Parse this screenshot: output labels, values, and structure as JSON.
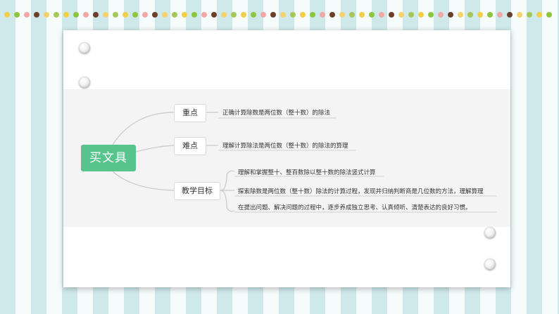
{
  "mindmap": {
    "root": "买文具",
    "topics": [
      {
        "label": "重点",
        "items": [
          "正确计算除数是两位数（整十数）的除法"
        ]
      },
      {
        "label": "难点",
        "items": [
          "理解计算除法是两位数（整十数）的除法的算理"
        ]
      },
      {
        "label": "教学目标",
        "items": [
          "理解和掌握整十、整百数除以整十数的除法竖式计算",
          "探索除数是两位数（整十数）除法的计算过程，发现并归纳判断商是几位数的方法，理解算理",
          "在提出问题、解决问题的过程中，逐步养成独立思考、认真倾听、清楚表达的良好习惯。"
        ]
      }
    ]
  },
  "colors": {
    "root_fill": "#58c48d",
    "dot_palette": [
      "#f2cf47",
      "#8cc63f",
      "#f2a7a7",
      "#6b3f2a",
      "#f5d26b",
      "#a6c85a"
    ]
  }
}
